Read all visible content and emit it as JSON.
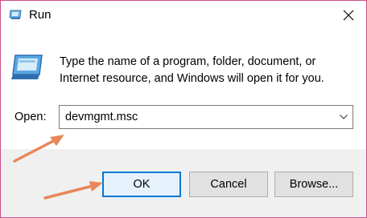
{
  "window": {
    "title": "Run",
    "title_icon": "run-icon",
    "close_icon": "close-icon"
  },
  "prompt": {
    "icon": "run-app-icon",
    "text": "Type the name of a program, folder, document, or Internet resource, and Windows will open it for you."
  },
  "open_field": {
    "label": "Open:",
    "value": "devmgmt.msc",
    "dropdown_icon": "chevron-down-icon"
  },
  "buttons": {
    "ok": "OK",
    "cancel": "Cancel",
    "browse": "Browse..."
  },
  "annotations": {
    "arrow_color": "#e8875a",
    "arrows": [
      "annotation-arrow-to-field",
      "annotation-arrow-to-ok"
    ]
  },
  "colors": {
    "frame_border": "#c94f86",
    "accent": "#0078d7",
    "footer_bg": "#f0f0f0"
  }
}
